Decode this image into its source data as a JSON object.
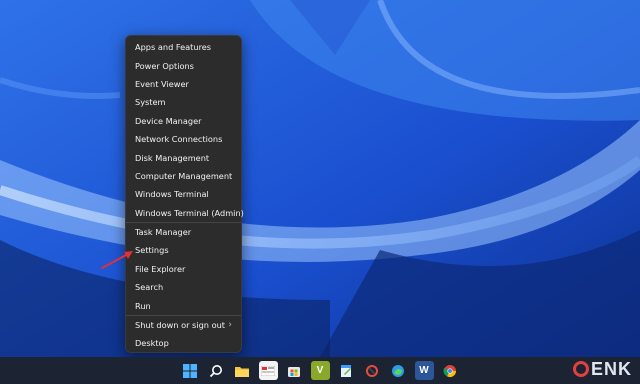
{
  "context_menu": {
    "items": [
      {
        "label": "Apps and Features"
      },
      {
        "label": "Power Options"
      },
      {
        "label": "Event Viewer"
      },
      {
        "label": "System"
      },
      {
        "label": "Device Manager"
      },
      {
        "label": "Network Connections"
      },
      {
        "label": "Disk Management"
      },
      {
        "label": "Computer Management"
      },
      {
        "label": "Windows Terminal"
      },
      {
        "label": "Windows Terminal (Admin)"
      },
      {
        "label": "Task Manager"
      },
      {
        "label": "Settings"
      },
      {
        "label": "File Explorer"
      },
      {
        "label": "Search"
      },
      {
        "label": "Run"
      },
      {
        "label": "Shut down or sign out"
      },
      {
        "label": "Desktop"
      }
    ],
    "submenu_arrow": "›"
  },
  "taskbar": {
    "icons": [
      "windows-start-icon",
      "search-icon",
      "file-explorer-icon",
      "mail-app-icon",
      "microsoft-store-icon",
      "vim-icon",
      "notepad-icon",
      "snipping-tool-icon",
      "edge-icon",
      "word-icon",
      "chrome-icon"
    ],
    "word_letter": "W",
    "vim_letter": "V"
  },
  "watermark": {
    "text": "ENK"
  },
  "colors": {
    "menu_bg": "#2c2c2c",
    "taskbar_bg": "#1c2332",
    "arrow": "#e0303a"
  }
}
